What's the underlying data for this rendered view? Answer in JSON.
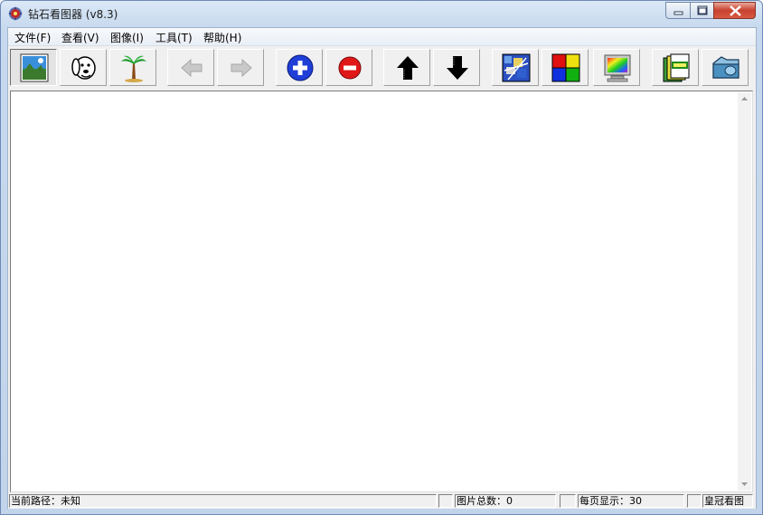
{
  "window": {
    "title": "钻石看图器 (v8.3)"
  },
  "menu": [
    {
      "label": "文件(F)"
    },
    {
      "label": "查看(V)"
    },
    {
      "label": "图像(I)"
    },
    {
      "label": "工具(T)"
    },
    {
      "label": "帮助(H)"
    }
  ],
  "toolbar": {
    "buttons": [
      {
        "icon": "landscape-image-icon",
        "state": "pressed"
      },
      {
        "icon": "dog-icon",
        "state": "normal"
      },
      {
        "icon": "palm-tree-icon",
        "state": "normal"
      },
      {
        "icon": "arrow-left-icon",
        "state": "disabled"
      },
      {
        "icon": "arrow-right-icon",
        "state": "disabled"
      },
      {
        "icon": "zoom-in-plus-icon",
        "state": "normal"
      },
      {
        "icon": "zoom-out-minus-icon",
        "state": "normal"
      },
      {
        "icon": "arrow-up-icon",
        "state": "normal"
      },
      {
        "icon": "arrow-down-icon",
        "state": "normal"
      },
      {
        "icon": "mosaic-image-icon",
        "state": "normal"
      },
      {
        "icon": "color-squares-icon",
        "state": "normal"
      },
      {
        "icon": "monitor-icon",
        "state": "normal"
      },
      {
        "icon": "labels-icon",
        "state": "normal"
      },
      {
        "icon": "folder-icon",
        "state": "normal"
      }
    ]
  },
  "status": {
    "path_label": "当前路径：未知",
    "total_label": "图片总数：0",
    "per_page_label": "每页显示：30",
    "brand_label": "皇冠看图"
  },
  "colors": {
    "accent_blue": "#1f3fd6",
    "stop_red": "#e01818"
  }
}
